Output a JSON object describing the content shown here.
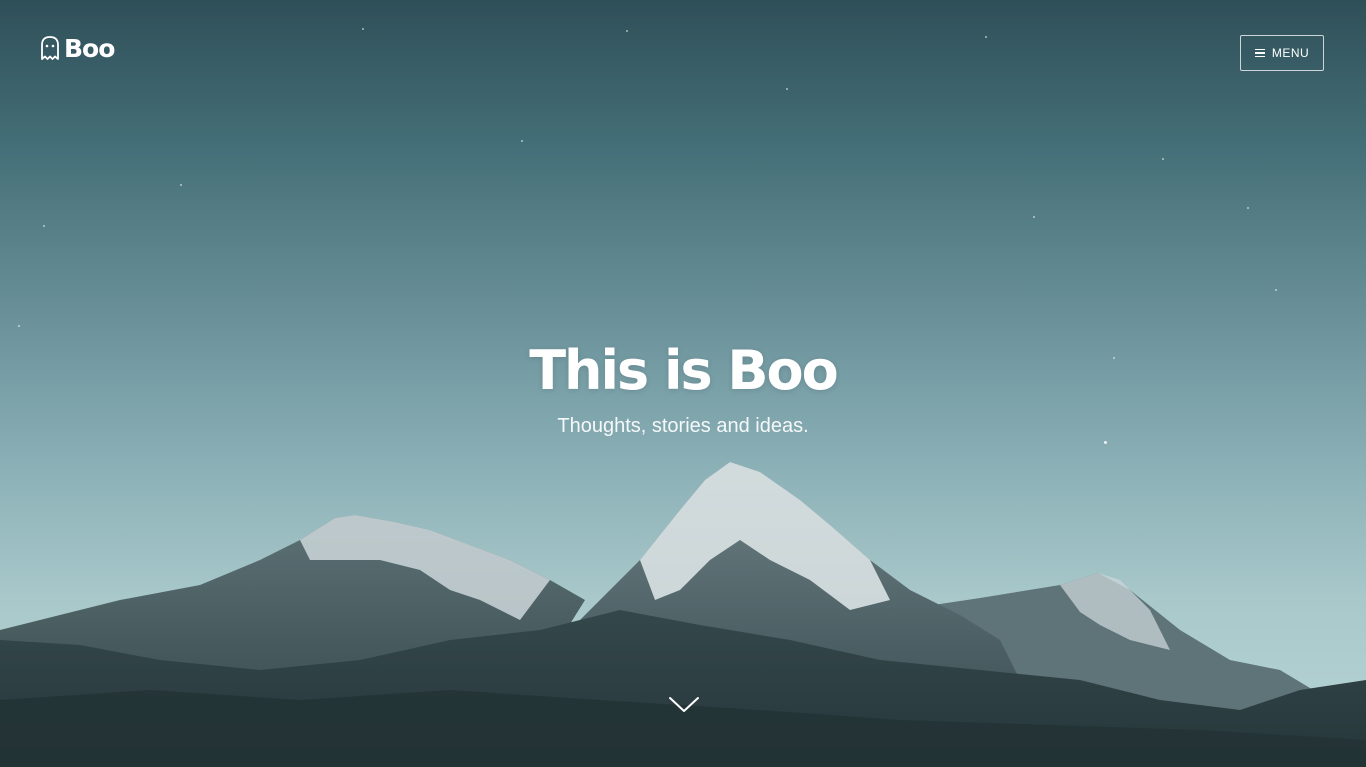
{
  "site": {
    "logo_text": "Boo",
    "logo_icon": "ghost-icon"
  },
  "header": {
    "menu_label": "MENU",
    "menu_icon": "hamburger-icon"
  },
  "hero": {
    "title": "This is Boo",
    "subtitle": "Thoughts, stories and ideas.",
    "scroll_icon": "chevron-down-icon"
  },
  "colors": {
    "text": "#ffffff",
    "sky_top": "#2f4f58",
    "sky_bottom": "#b9d6d6",
    "mountain_dark": "#2c3f42"
  }
}
